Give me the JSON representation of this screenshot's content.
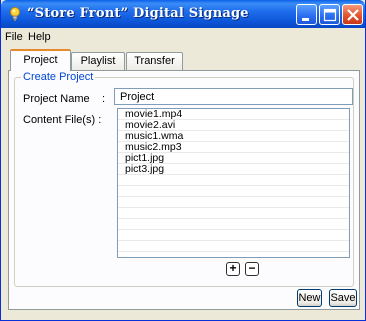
{
  "window": {
    "title": "“Store Front” Digital Signage"
  },
  "menu": {
    "file": "File",
    "help": "Help"
  },
  "tabs": [
    {
      "label": "Project",
      "active": true
    },
    {
      "label": "Playlist",
      "active": false
    },
    {
      "label": "Transfer",
      "active": false
    }
  ],
  "group": {
    "legend": "Create Project"
  },
  "form": {
    "name_label": "Project Name",
    "name_colon": ":",
    "name_value": "Project",
    "content_label": "Content File(s) :"
  },
  "content_files": [
    "movie1.mp4",
    "movie2.avi",
    "music1.wma",
    "music2.mp3",
    "pict1.jpg",
    "pict3.jpg"
  ],
  "list_buttons": {
    "add": "+",
    "remove": "−"
  },
  "buttons": {
    "new": "New",
    "save": "Save"
  },
  "colors": {
    "title_bar": "#0b53d6",
    "group_legend": "#0046d5",
    "active_tab_accent": "#e68b2c"
  }
}
